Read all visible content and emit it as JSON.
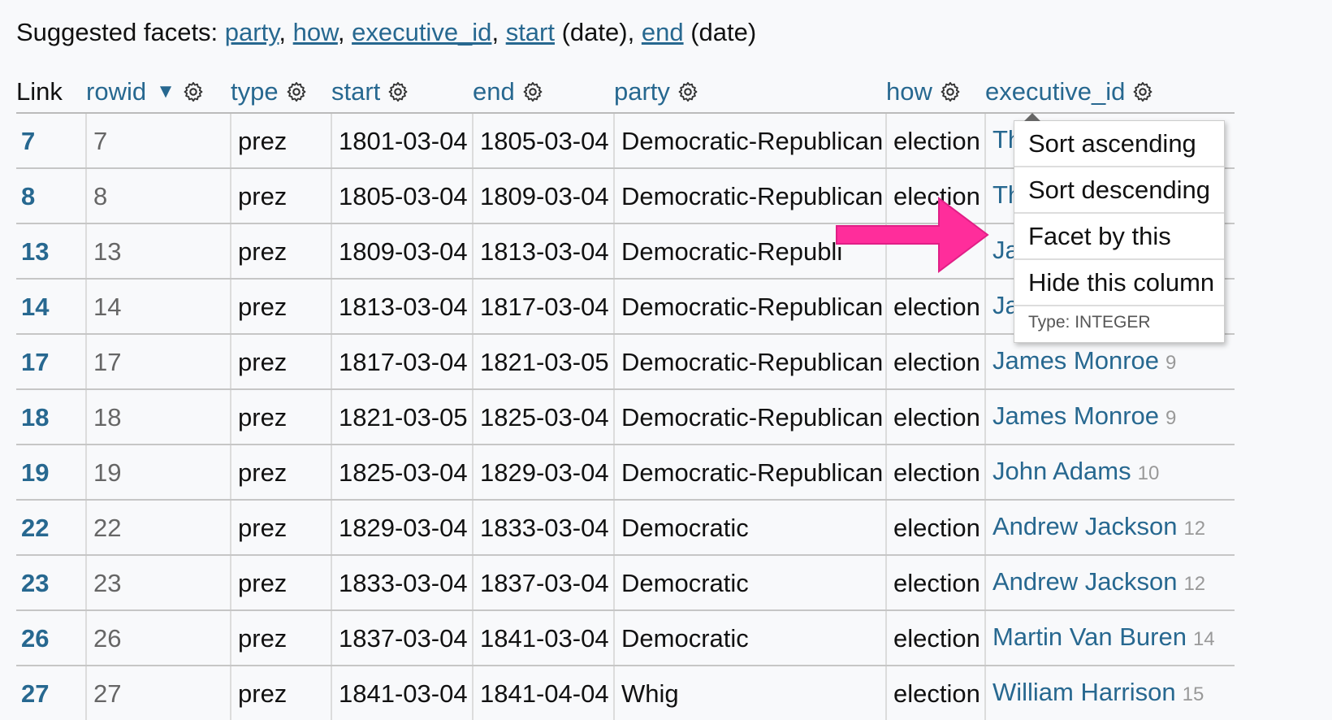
{
  "facets": {
    "prefix": "Suggested facets:",
    "items": [
      {
        "label": "party",
        "suffix": ""
      },
      {
        "label": "how",
        "suffix": ""
      },
      {
        "label": "executive_id",
        "suffix": ""
      },
      {
        "label": "start",
        "suffix": " (date)"
      },
      {
        "label": "end",
        "suffix": " (date)"
      }
    ]
  },
  "table": {
    "columns": {
      "link": "Link",
      "rowid": "rowid",
      "rowid_sort": "▼",
      "type": "type",
      "start": "start",
      "end": "end",
      "party": "party",
      "how": "how",
      "executive_id": "executive_id"
    },
    "rows": [
      {
        "link": "7",
        "rowid": "7",
        "type": "prez",
        "start": "1801-03-04",
        "end": "1805-03-04",
        "party": "Democratic-Republican",
        "how": "election",
        "exec_name": "Th",
        "exec_id": ""
      },
      {
        "link": "8",
        "rowid": "8",
        "type": "prez",
        "start": "1805-03-04",
        "end": "1809-03-04",
        "party": "Democratic-Republican",
        "how": "election",
        "exec_name": "Th",
        "exec_id": ""
      },
      {
        "link": "13",
        "rowid": "13",
        "type": "prez",
        "start": "1809-03-04",
        "end": "1813-03-04",
        "party": "Democratic-Republi",
        "how": "",
        "exec_name": "Ja",
        "exec_id": ""
      },
      {
        "link": "14",
        "rowid": "14",
        "type": "prez",
        "start": "1813-03-04",
        "end": "1817-03-04",
        "party": "Democratic-Republican",
        "how": "election",
        "exec_name": "Ja",
        "exec_id": ""
      },
      {
        "link": "17",
        "rowid": "17",
        "type": "prez",
        "start": "1817-03-04",
        "end": "1821-03-05",
        "party": "Democratic-Republican",
        "how": "election",
        "exec_name": "James Monroe",
        "exec_id": "9"
      },
      {
        "link": "18",
        "rowid": "18",
        "type": "prez",
        "start": "1821-03-05",
        "end": "1825-03-04",
        "party": "Democratic-Republican",
        "how": "election",
        "exec_name": "James Monroe",
        "exec_id": "9"
      },
      {
        "link": "19",
        "rowid": "19",
        "type": "prez",
        "start": "1825-03-04",
        "end": "1829-03-04",
        "party": "Democratic-Republican",
        "how": "election",
        "exec_name": "John Adams",
        "exec_id": "10"
      },
      {
        "link": "22",
        "rowid": "22",
        "type": "prez",
        "start": "1829-03-04",
        "end": "1833-03-04",
        "party": "Democratic",
        "how": "election",
        "exec_name": "Andrew Jackson",
        "exec_id": "12"
      },
      {
        "link": "23",
        "rowid": "23",
        "type": "prez",
        "start": "1833-03-04",
        "end": "1837-03-04",
        "party": "Democratic",
        "how": "election",
        "exec_name": "Andrew Jackson",
        "exec_id": "12"
      },
      {
        "link": "26",
        "rowid": "26",
        "type": "prez",
        "start": "1837-03-04",
        "end": "1841-03-04",
        "party": "Democratic",
        "how": "election",
        "exec_name": "Martin Van Buren",
        "exec_id": "14"
      },
      {
        "link": "27",
        "rowid": "27",
        "type": "prez",
        "start": "1841-03-04",
        "end": "1841-04-04",
        "party": "Whig",
        "how": "election",
        "exec_name": "William Harrison",
        "exec_id": "15"
      }
    ]
  },
  "menu": {
    "sort_asc": "Sort ascending",
    "sort_desc": "Sort descending",
    "facet": "Facet by this",
    "hide": "Hide this column",
    "type": "Type: INTEGER"
  },
  "icons": {
    "column_menu": "gear-icon",
    "annotation": "arrow-right-icon"
  },
  "colors": {
    "link": "#276890",
    "annotation_arrow": "#ff2d9b",
    "background": "#f8f9fb"
  }
}
